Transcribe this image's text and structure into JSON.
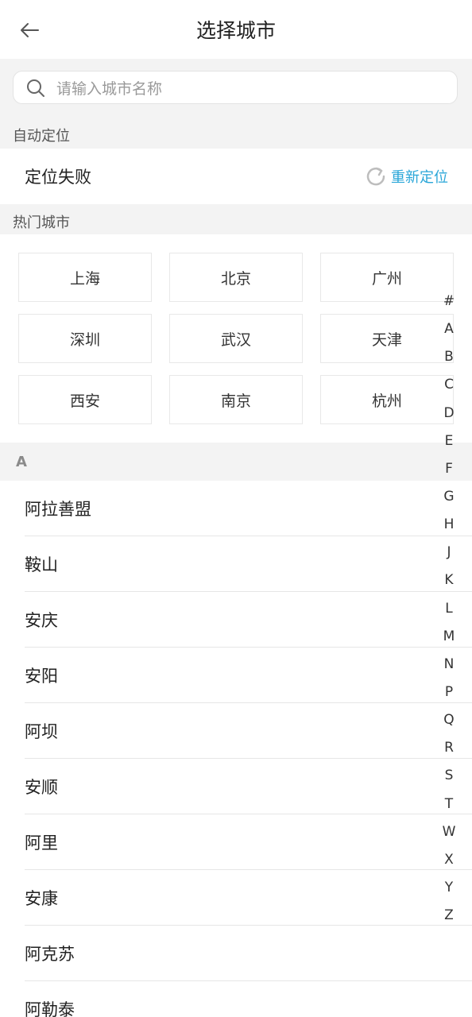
{
  "header": {
    "title": "选择城市"
  },
  "search": {
    "placeholder": "请输入城市名称"
  },
  "sections": {
    "auto_location": "自动定位",
    "hot_cities": "热门城市"
  },
  "location": {
    "status": "定位失败",
    "relocate_label": "重新定位"
  },
  "hot_cities": [
    "上海",
    "北京",
    "广州",
    "深圳",
    "武汉",
    "天津",
    "西安",
    "南京",
    "杭州"
  ],
  "city_group": {
    "letter": "A",
    "cities": [
      "阿拉善盟",
      "鞍山",
      "安庆",
      "安阳",
      "阿坝",
      "安顺",
      "阿里",
      "安康",
      "阿克苏",
      "阿勒泰"
    ]
  },
  "index_letters": [
    "#",
    "A",
    "B",
    "C",
    "D",
    "E",
    "F",
    "G",
    "H",
    "J",
    "K",
    "L",
    "M",
    "N",
    "P",
    "Q",
    "R",
    "S",
    "T",
    "W",
    "X",
    "Y",
    "Z"
  ],
  "colors": {
    "accent": "#2aa6d8",
    "background_gray": "#f3f3f3"
  },
  "icons": {
    "back": "arrow-left-icon",
    "search": "search-icon",
    "relocate": "refresh-icon"
  }
}
